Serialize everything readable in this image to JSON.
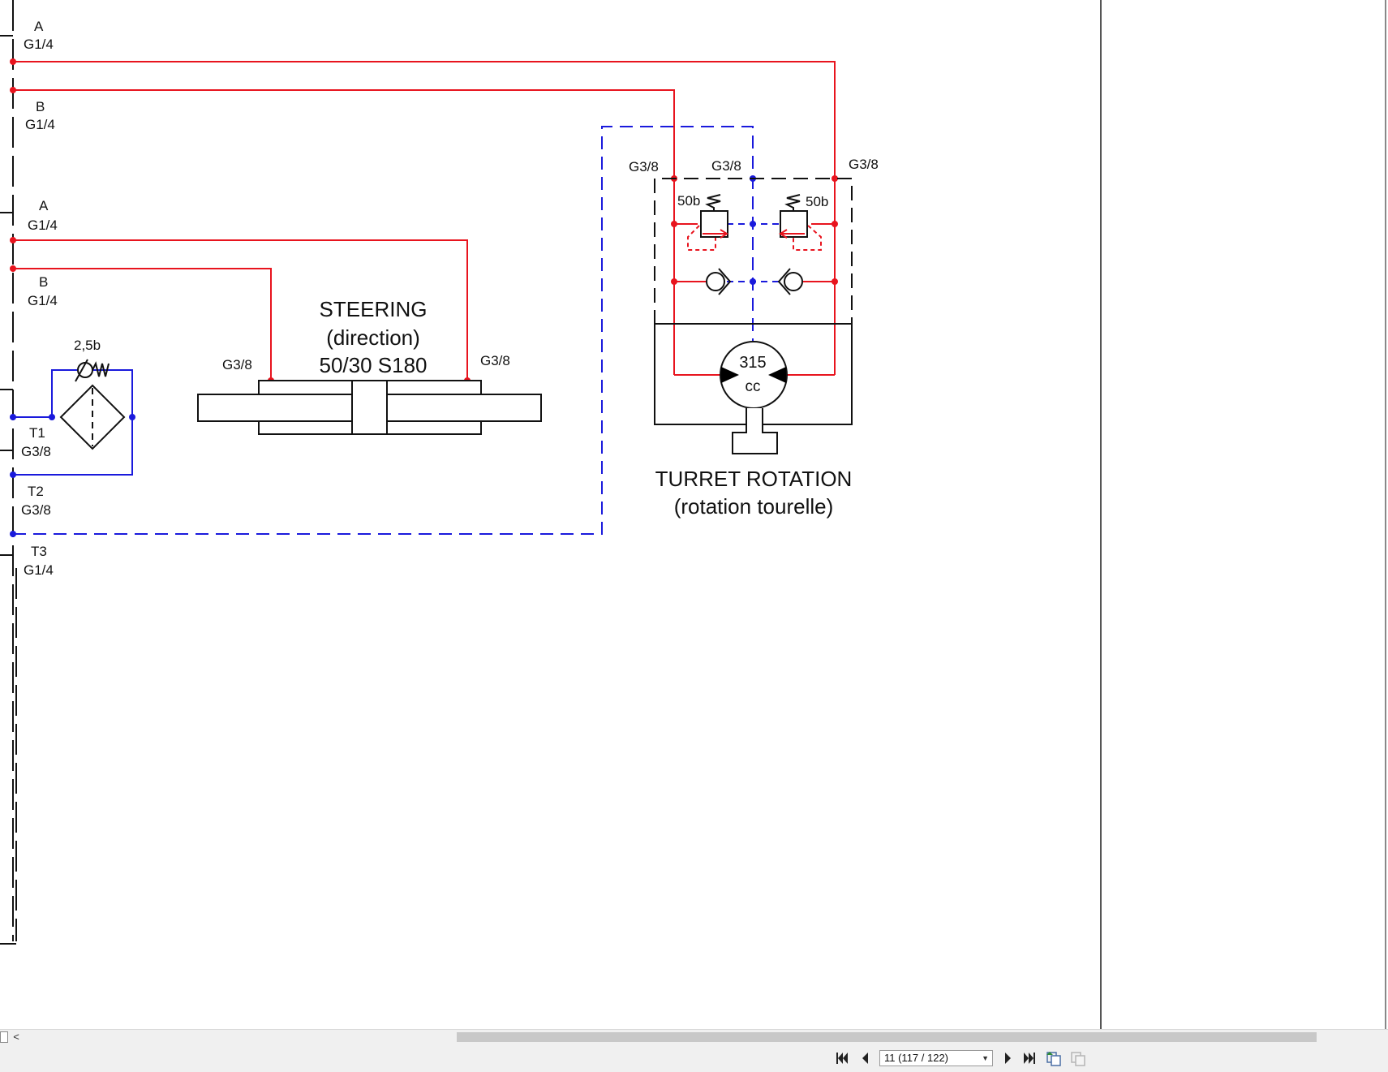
{
  "diagram": {
    "left_ports": [
      {
        "letter": "A",
        "thread": "G1/4"
      },
      {
        "letter": "B",
        "thread": "G1/4"
      },
      {
        "letter": "A",
        "thread": "G1/4"
      },
      {
        "letter": "B",
        "thread": "G1/4"
      },
      {
        "letter": "T1",
        "thread": "G3/8"
      },
      {
        "letter": "T2",
        "thread": "G3/8"
      },
      {
        "letter": "T3",
        "thread": "G1/4"
      }
    ],
    "filter_bypass_pressure": "2,5b",
    "steering": {
      "title_line1": "STEERING",
      "title_line2": "(direction)",
      "title_line3": "50/30 S180",
      "port_left": "G3/8",
      "port_right": "G3/8"
    },
    "turret": {
      "port_left": "G3/8",
      "port_middle": "G3/8",
      "port_right": "G3/8",
      "relief_left": "50b",
      "relief_right": "50b",
      "motor_displacement_value": "315",
      "motor_displacement_unit": "cc",
      "title_line1": "TURRET ROTATION",
      "title_line2": "(rotation tourelle)"
    },
    "colors": {
      "pressure_line": "#e8141e",
      "return_line": "#1a1adc",
      "outline": "#111111"
    }
  },
  "scrollbar": {
    "left_arrow": "<"
  },
  "navigation": {
    "page_indicator": "11 (117 / 122)",
    "icons": [
      "first-page-icon",
      "previous-page-icon",
      "next-page-icon",
      "last-page-icon",
      "copy-page-icon",
      "copy-page-disabled-icon"
    ]
  }
}
